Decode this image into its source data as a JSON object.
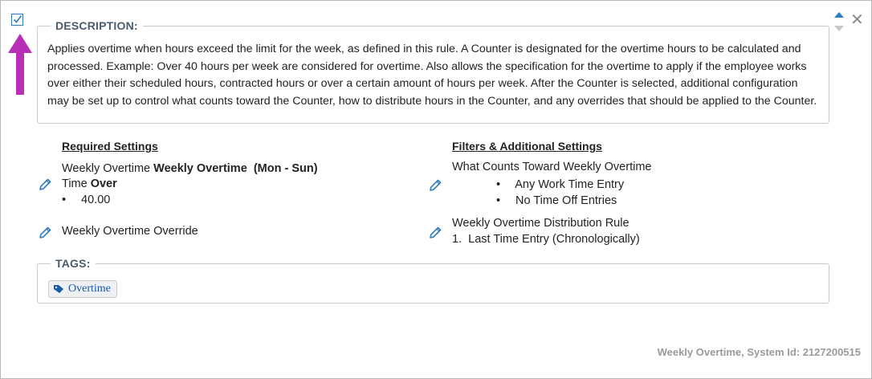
{
  "description": {
    "legend": "DESCRIPTION:",
    "text": "Applies overtime when hours exceed the limit for the week, as defined in this rule. A Counter is designated for the overtime hours to be calculated and processed. Example: Over 40 hours per week are considered for overtime. Also allows the specification for the overtime to apply if the employee works over either their scheduled hours, contracted hours or over a certain amount of hours per week. After the Counter is selected, additional configuration may be set up to control what counts toward the Counter, how to distribute hours in the Counter, and any overrides that should be applied to the Counter."
  },
  "required": {
    "title": "Required Settings",
    "line1_prefix": "Weekly Overtime ",
    "line1_bold": "Weekly Overtime  (Mon - Sun)",
    "line2_prefix": "Time ",
    "line2_bold": "Over",
    "value": "40.00",
    "override": "Weekly Overtime Override"
  },
  "filters": {
    "title": "Filters & Additional Settings",
    "counts_label": "What Counts Toward Weekly Overtime",
    "counts_items": [
      "Any Work Time Entry",
      "No Time Off Entries"
    ],
    "distribution_label": "Weekly Overtime Distribution Rule",
    "distribution_item": "1.  Last Time Entry (Chronologically)"
  },
  "tags": {
    "legend": "TAGS:",
    "items": [
      "Overtime"
    ]
  },
  "footer": "Weekly Overtime, System Id: 2127200515",
  "colors": {
    "accent": "#2f7bbf",
    "arrow": "#b72fb4",
    "legend": "#4a5c6e",
    "footer": "#9a9a9a"
  },
  "icons": [
    "checkbox-checked-icon",
    "arrow-up-icon",
    "sort-icon",
    "close-icon",
    "pencil-icon",
    "tag-icon"
  ]
}
